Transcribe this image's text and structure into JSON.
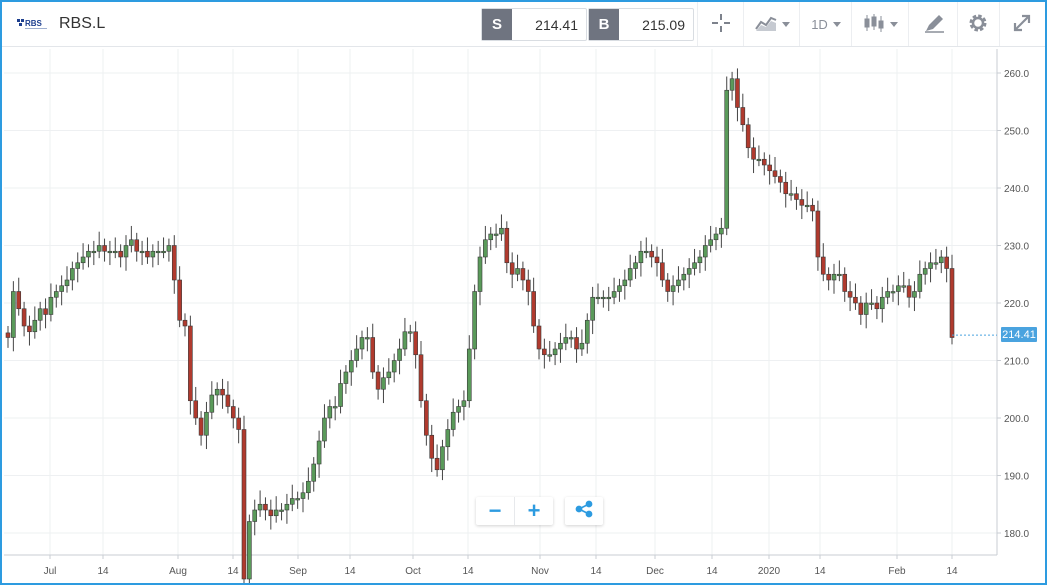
{
  "header": {
    "logo_text": "RBS",
    "symbol": "RBS.L",
    "sell_label": "S",
    "sell_price": "214.41",
    "buy_label": "B",
    "buy_price": "215.09",
    "interval": "1D"
  },
  "icons": [
    "crosshair-icon",
    "line-chart-icon",
    "candlestick-icon",
    "draw-icon",
    "gear-icon",
    "fullscreen-icon",
    "zoom-out-icon",
    "zoom-in-icon",
    "share-icon"
  ],
  "controls": {
    "zoom_out_label": "−",
    "zoom_in_label": "+"
  },
  "colors": {
    "up": "#5a9a5a",
    "down": "#b03a2e",
    "accent": "#2d9be0",
    "last_price_tag": "#4aa3df"
  },
  "chart_data": {
    "type": "candlestick",
    "last_price": "214.41",
    "ylim": [
      175,
      263
    ],
    "yticks": [
      180,
      190,
      200,
      210,
      220,
      230,
      240,
      250,
      260
    ],
    "grid": true,
    "xticks": [
      "Jul",
      "14",
      "Aug",
      "14",
      "Sep",
      "14",
      "Oct",
      "14",
      "Nov",
      "14",
      "Dec",
      "14",
      "2020",
      "14",
      "Feb",
      "14"
    ],
    "closes": [
      214,
      222,
      219,
      216,
      215,
      217,
      219,
      218,
      221,
      222,
      223,
      224,
      226,
      227,
      228,
      229,
      229,
      230,
      229,
      229,
      229,
      228,
      230,
      231,
      229,
      229,
      228,
      229,
      229,
      229,
      230,
      224,
      217,
      216,
      203,
      200,
      197,
      201,
      204,
      205,
      204,
      202,
      200,
      198,
      172,
      182,
      184,
      185,
      184,
      183,
      184,
      184,
      185,
      186,
      186,
      187,
      189,
      192,
      196,
      200,
      202,
      202,
      206,
      208,
      210,
      212,
      214,
      214,
      208,
      205,
      207,
      208,
      210,
      212,
      215,
      215,
      211,
      203,
      197,
      193,
      191,
      195,
      198,
      201,
      202,
      203,
      212,
      222,
      228,
      231,
      232,
      232,
      233,
      227,
      225,
      226,
      224,
      222,
      216,
      212,
      211,
      211,
      212,
      213,
      214,
      214,
      212,
      213,
      217,
      221,
      221,
      221,
      221,
      222,
      223,
      224,
      226,
      227,
      229,
      229,
      228,
      227,
      224,
      222,
      223,
      224,
      225,
      226,
      227,
      228,
      230,
      231,
      232,
      233,
      257,
      259,
      254,
      251,
      247,
      245,
      245,
      244,
      243,
      242,
      241,
      239,
      239,
      238,
      237,
      237,
      236,
      228,
      225,
      224,
      225,
      225,
      222,
      221,
      220,
      218,
      220,
      220,
      219,
      221,
      222,
      222,
      223,
      223,
      221,
      222,
      225,
      226,
      227,
      227,
      228,
      226,
      214
    ]
  }
}
